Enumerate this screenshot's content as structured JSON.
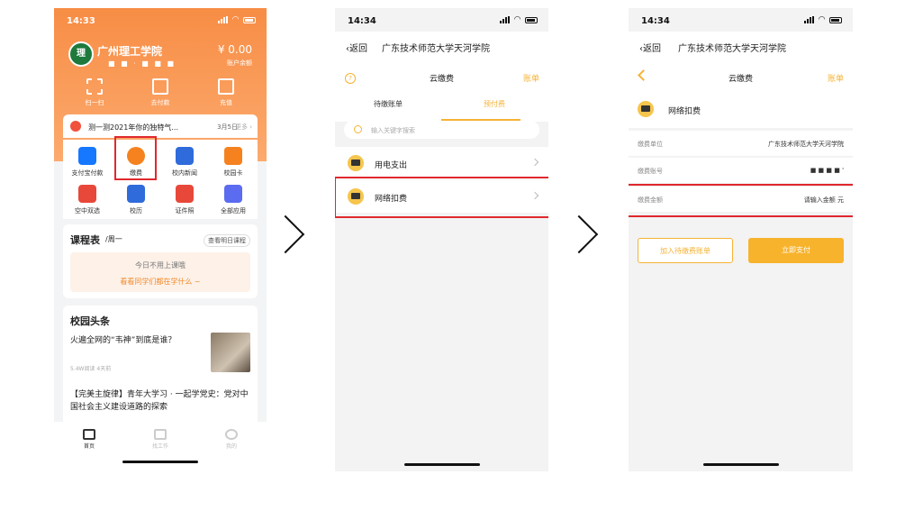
{
  "phone1": {
    "status_time": "14:33",
    "school_name": "广州理工学院",
    "logo_text": "理",
    "masked_account": "■ ■ · ■ ■ ■",
    "balance": "¥ 0.00",
    "balance_label": "账户余额",
    "quick_actions": [
      {
        "label": "扫一扫",
        "icon": "scan-icon"
      },
      {
        "label": "去付款",
        "icon": "qr-code-icon"
      },
      {
        "label": "充值",
        "icon": "recharge-icon"
      }
    ],
    "notice": {
      "text": "测一测2021年你的独特气...",
      "date": "3月5日",
      "more": "更多 ›"
    },
    "services": [
      {
        "label": "支付宝付款",
        "icon": "alipay-icon",
        "color": "#1677ff"
      },
      {
        "label": "缴费",
        "icon": "payment-icon",
        "color": "#f5821f"
      },
      {
        "label": "校内新闻",
        "icon": "news-icon",
        "color": "#2f6bdb"
      },
      {
        "label": "校园卡",
        "icon": "campus-card-icon",
        "color": "#f5821f"
      },
      {
        "label": "空中双选",
        "icon": "handshake-icon",
        "color": "#e8483a"
      },
      {
        "label": "校历",
        "icon": "calendar-icon",
        "color": "#2f6bdb"
      },
      {
        "label": "证件照",
        "icon": "id-photo-icon",
        "color": "#e8483a"
      },
      {
        "label": "全部应用",
        "icon": "all-apps-icon",
        "color": "#5b6cf0"
      }
    ],
    "course": {
      "title": "课程表",
      "day": "/周一",
      "button": "查看明日课程",
      "empty": "今日不用上课哦",
      "link": "看看同学们都在学什么 ~"
    },
    "news": {
      "title": "校园头条",
      "headline1": "火遍全网的“韦神”到底是谁？",
      "meta": "5.4W阅读    4天前",
      "headline2": "【完美主旋律】青年大学习 · 一起学党史：党对中国社会主义建设道路的探索"
    },
    "tabs": [
      {
        "label": "首页",
        "icon": "home-icon"
      },
      {
        "label": "找工作",
        "icon": "job-icon"
      },
      {
        "label": "我的",
        "icon": "profile-icon"
      }
    ]
  },
  "phone2": {
    "status_time": "14:34",
    "back": "‹返回",
    "school": "广东技术师范大学天河学院",
    "help": "?",
    "title": "云缴费",
    "bill": "账单",
    "tabs": [
      "待缴账单",
      "预付费"
    ],
    "search_placeholder": "输入关键字搜索",
    "rows": [
      {
        "label": "用电支出",
        "icon": "electricity-icon"
      },
      {
        "label": "网络扣费",
        "icon": "network-icon"
      }
    ]
  },
  "phone3": {
    "status_time": "14:34",
    "back": "‹返回",
    "school": "广东技术师范大学天河学院",
    "title": "云缴费",
    "bill": "账单",
    "item": "网络扣费",
    "fields": [
      {
        "key": "缴费单位",
        "value": "广东技术师范大学天河学院"
      },
      {
        "key": "缴费账号",
        "value": "■ ■    ■ ■ '"
      },
      {
        "key": "缴费金额",
        "value": "请输入金额  元"
      }
    ],
    "add_button": "加入待缴费账单",
    "pay_button": "立即支付"
  },
  "colors": {
    "accent_orange": "#f78d45",
    "accent_yellow": "#f5b335",
    "highlight_red": "#e0282e"
  }
}
